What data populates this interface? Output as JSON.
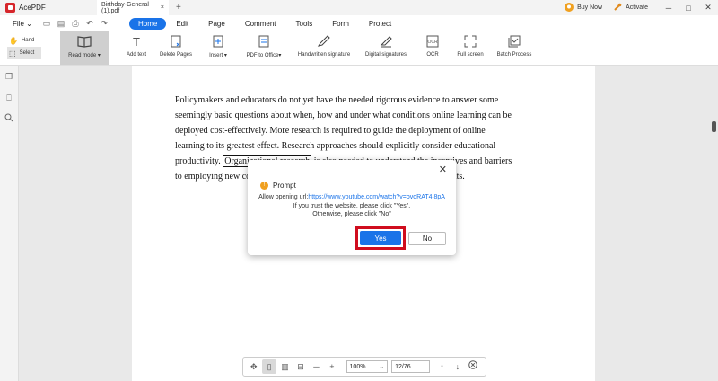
{
  "titlebar": {
    "app_name": "AcePDF",
    "doc_tab": "Birthday-General (1).pdf",
    "doc_tab_close": "×",
    "new_tab": "+",
    "buy_now": "Buy Now",
    "activate": "Activate",
    "minimize": "─",
    "maximize": "□",
    "close": "✕"
  },
  "menubar": {
    "file": "File",
    "items": [
      "Home",
      "Edit",
      "Page",
      "Comment",
      "Tools",
      "Form",
      "Protect"
    ]
  },
  "ribbon": {
    "hand": "Hand",
    "select": "Select",
    "tools": [
      {
        "label": "Read mode ▾",
        "icon": "book-icon"
      },
      {
        "label": "Add text",
        "icon": "text-icon"
      },
      {
        "label": "Delete Pages",
        "icon": "delete-pages-icon"
      },
      {
        "label": "Insert ▾",
        "icon": "insert-icon"
      },
      {
        "label": "PDF to Office▾",
        "icon": "pdf-to-office-icon"
      },
      {
        "label": "Handwritten signature",
        "icon": "pen-icon"
      },
      {
        "label": "Digital signatures",
        "icon": "digital-signature-icon"
      },
      {
        "label": "OCR",
        "icon": "ocr-icon"
      },
      {
        "label": "Full screen",
        "icon": "fullscreen-icon"
      },
      {
        "label": "Batch Process",
        "icon": "batch-icon"
      }
    ]
  },
  "document": {
    "text_before": "Policymakers and educators do not yet have the needed rigorous evidence to answer some seemingly basic questions about when, how and under what conditions online learning can be deployed cost-effectively. More research is required to guide the deployment of online learning to its greatest effect. Research approaches should explicitly consider educational productivity. ",
    "highlight": "Organizational research",
    "text_after": " is also needed to understand the incentives and barriers to employing new cost-effective approaches to quality education for all students."
  },
  "dialog": {
    "title": "Prompt",
    "line1_prefix": "Allow opening url:",
    "url": "https://www.youtube.com/watch?v=ovoRAT4I8pA",
    "line2": "If you trust the website, please click \"Yes\".",
    "line3": "Otherwise, please click \"No\"",
    "yes": "Yes",
    "no": "No",
    "close": "✕"
  },
  "bottombar": {
    "zoom": "100%",
    "page": "12/76"
  },
  "colors": {
    "accent": "#1a73e8",
    "highlight_frame": "#d00d1e",
    "logo": "#d6262b"
  }
}
